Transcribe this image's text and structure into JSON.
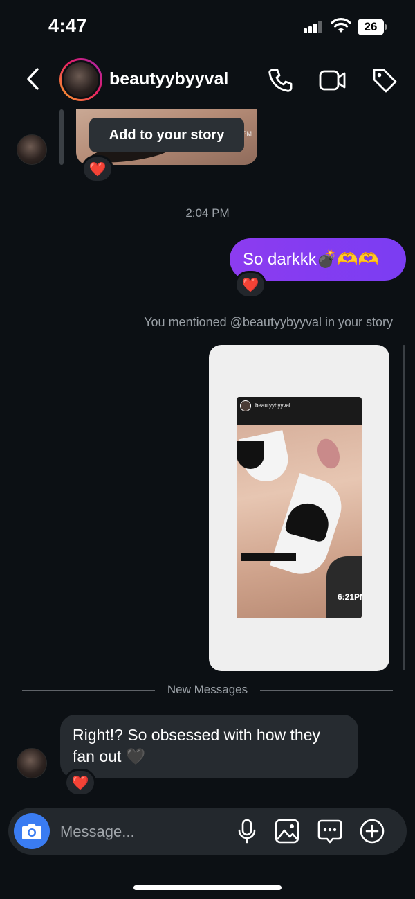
{
  "status_bar": {
    "time": "4:47",
    "battery": "26"
  },
  "header": {
    "username": "beautyybyyval"
  },
  "earlier_story": {
    "add_to_story_label": "Add to your story",
    "thumb_time": "PM",
    "reaction": "❤️"
  },
  "time_separator": "2:04 PM",
  "sent_message": {
    "text": "So darkkk💣🫶🫶",
    "reaction": "❤️"
  },
  "mention_note": "You mentioned @beautyybyyval in your story",
  "shared_story": {
    "username": "beautyybyyval",
    "time": "6:21PM"
  },
  "new_messages_label": "New Messages",
  "received_message": {
    "text": "Right!? So obsessed with how they fan out 🖤",
    "reaction": "❤️"
  },
  "composer": {
    "placeholder": "Message..."
  },
  "icons": {
    "back": "chevron-left-icon",
    "call": "phone-icon",
    "video": "video-icon",
    "tag": "tag-icon",
    "camera": "camera-icon",
    "mic": "microphone-icon",
    "gallery": "image-icon",
    "sticker": "chat-bubble-icon",
    "add": "plus-circle-icon"
  },
  "colors": {
    "background": "#0c1014",
    "sent_bubble": "#8c3cf0",
    "received_bubble": "#262b30",
    "camera_button": "#3a7cf2"
  }
}
